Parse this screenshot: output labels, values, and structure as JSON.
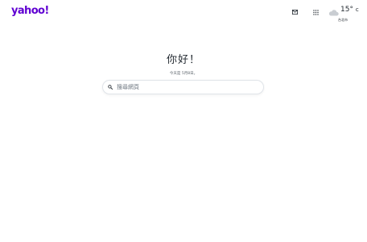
{
  "header": {
    "logo": "yahoo!",
    "icons": {
      "mail": "mail-icon",
      "apps": "apps-grid-icon"
    },
    "weather": {
      "temp": "15°",
      "unit": "c",
      "location": "台北市",
      "icon": "cloud-icon"
    }
  },
  "hero": {
    "greeting": "你好！",
    "date": "今天是 5月8日。"
  },
  "search": {
    "placeholder": "搜尋網頁",
    "value": "",
    "icon": "search-icon"
  },
  "colors": {
    "brand": "#6001d2",
    "text": "#232a31",
    "muted": "#5b636a",
    "border": "#e0e4e9"
  }
}
